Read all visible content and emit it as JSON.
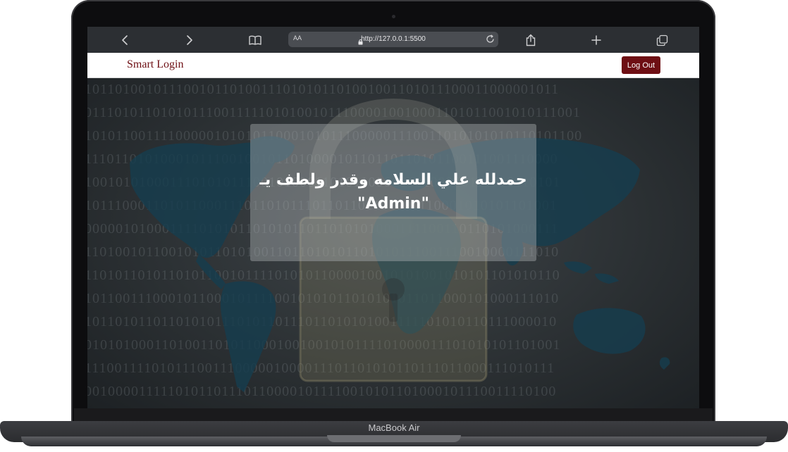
{
  "device": {
    "brand_label": "MacBook Air"
  },
  "browser": {
    "text_size_label": "AA",
    "url": "http://127.0.0.1:5500",
    "icons": [
      "back-icon",
      "forward-icon",
      "book-icon",
      "lock-icon",
      "reload-icon",
      "share-icon",
      "plus-icon",
      "tabs-icon"
    ]
  },
  "navbar": {
    "brand": "Smart Login",
    "logout_label": "Log Out",
    "accent_color": "#6e0f14"
  },
  "hero": {
    "message_line1": "حمدلله علي السلامه وقدر ولطف يـ",
    "message_line2": "\"Admin\"",
    "binary_rows": [
      "10110100101110010110100111010101101001001101011100011000001011",
      "01110101101010111001111101010010111000010010001101011001010111001",
      "10101100111100000101010110001010111000001110011010101010110101100",
      "11101101010001011100100101101000010110110110101100111001110000",
      "10010101000111010101110010100011010110001010100000111010110101",
      "10111000110101100011101101011101101101101001110001010101101001",
      "00000101000111101010110101011011010101000111100110110101000111",
      "11010010110010101101010011011010101101010111001110010000111010",
      "11010110101101011001011110101011000010010101001010101101010110",
      "10110011100010110001011110010101011010101011011000101000111010",
      "10110101101101010111010110111011010101001111101010110111000010",
      "01010100011010011010110001001001010111101000011101010101101001",
      "11100111101011100111000001000011101101010110111011000111010111",
      "00100001111101011011101100001011110010101101000101110011110100",
      "01001011100101101100101011100011010111010110110101101001011010",
      "01010110101011001110101100011100000100001110110101101001110110"
    ]
  }
}
